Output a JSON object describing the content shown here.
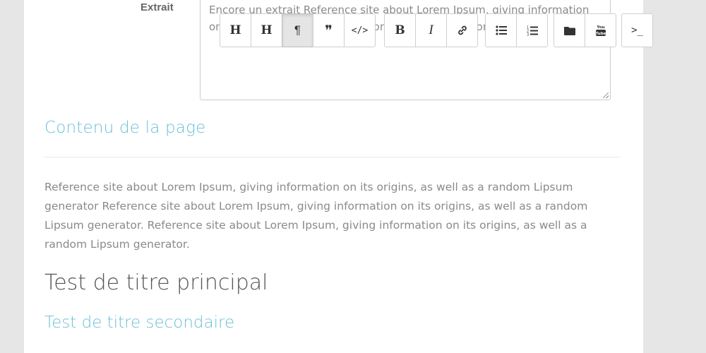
{
  "form": {
    "excerpt_label": "Extrait",
    "excerpt_value": "Encore un extrait Reference site about Lorem Ipsum, giving information on its origins, as well as a random Lipsum generator."
  },
  "toolbar": {
    "heading1": "H",
    "heading2": "H",
    "paragraph": "¶",
    "quote": "❞",
    "code": "</>",
    "bold": "B",
    "italic": "I",
    "link": "link",
    "bullet_list": "list-ul",
    "numbered_list": "list-ol",
    "folder": "folder",
    "youtube": "YouTube",
    "console": ">_"
  },
  "content": {
    "section_title": "Contenu de la page",
    "body": "Reference site about Lorem Ipsum, giving information on its origins, as well as a random Lipsum generator Reference site about Lorem Ipsum, giving information on its origins, as well as a random Lipsum generator. Reference site about Lorem Ipsum, giving information on its origins, as well as a random Lipsum generator.",
    "main_heading": "Test de titre principal",
    "secondary_heading": "Test de titre secondaire"
  },
  "colors": {
    "accent": "#6cc0d6",
    "text": "#8a8a8a",
    "page_bg": "#e6e6e6"
  }
}
